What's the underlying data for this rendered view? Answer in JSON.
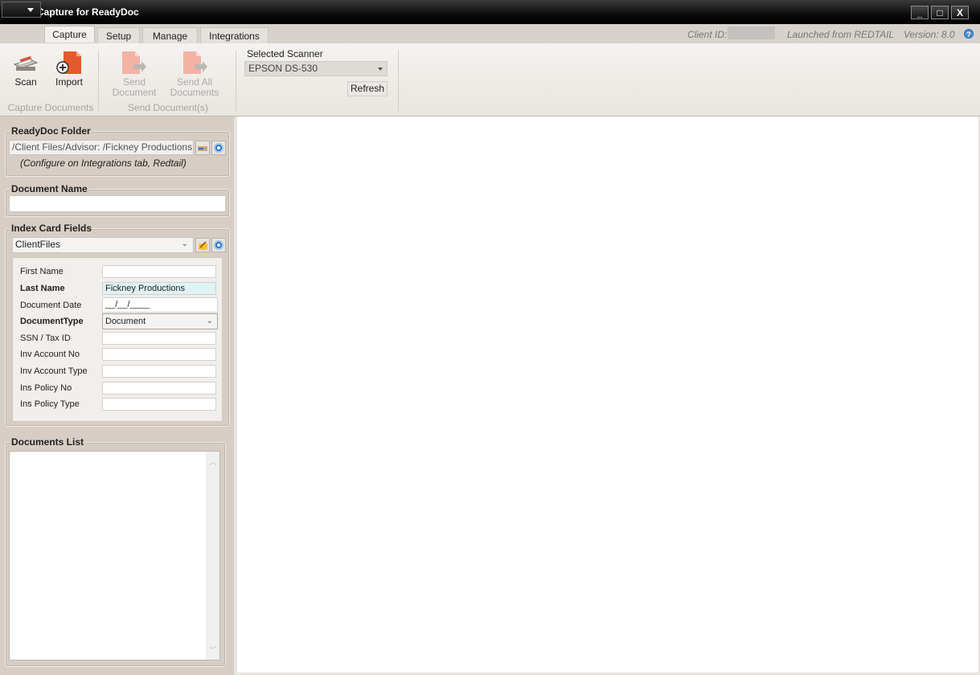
{
  "window": {
    "title": "ReadyCapture for ReadyDoc",
    "controls": {
      "minimize": "_",
      "maximize": "□",
      "close": "X"
    }
  },
  "tabs": [
    {
      "label": "Capture",
      "active": true
    },
    {
      "label": "Setup",
      "active": false
    },
    {
      "label": "Manage",
      "active": false
    },
    {
      "label": "Integrations",
      "active": false
    }
  ],
  "status": {
    "client_id_label": "Client ID:",
    "launched_from": "Launched from REDTAIL",
    "version": "Version: 8.0"
  },
  "ribbon": {
    "scan_label": "Scan",
    "import_label": "Import",
    "capture_group_label": "Capture Documents",
    "send_document_line1": "Send",
    "send_document_line2": "Document",
    "send_all_line1": "Send All",
    "send_all_line2": "Documents",
    "send_group_label": "Send Document(s)",
    "scanner_label": "Selected Scanner",
    "scanner_value": "EPSON DS-530",
    "refresh_label": "Refresh"
  },
  "readydoc_folder": {
    "title": "ReadyDoc Folder",
    "path": "/Client Files/Advisor: /Fickney Productions",
    "note": "(Configure on Integrations tab, Redtail)"
  },
  "document_name": {
    "title": "Document Name",
    "value": ""
  },
  "index_card": {
    "title": "Index Card Fields",
    "selected": "ClientFiles",
    "fields": [
      {
        "label": "First Name",
        "value": "",
        "bold": false
      },
      {
        "label": "Last Name",
        "value": "Fickney Productions",
        "bold": true
      },
      {
        "label": "Document Date",
        "value": "__/__/____",
        "bold": false
      },
      {
        "label": "DocumentType",
        "value": "Document",
        "bold": true
      },
      {
        "label": "SSN / Tax ID",
        "value": "",
        "bold": false
      },
      {
        "label": "Inv Account No",
        "value": "",
        "bold": false
      },
      {
        "label": "Inv Account Type",
        "value": "",
        "bold": false
      },
      {
        "label": "Ins Policy No",
        "value": "",
        "bold": false
      },
      {
        "label": "Ins Policy Type",
        "value": "",
        "bold": false
      }
    ]
  },
  "documents_list": {
    "title": "Documents List",
    "items": []
  },
  "colors": {
    "panel": "#d6cec5",
    "last_name_highlight": "#dff3f3",
    "icon_red": "#e0503a",
    "gear_blue": "#2e79c4"
  }
}
